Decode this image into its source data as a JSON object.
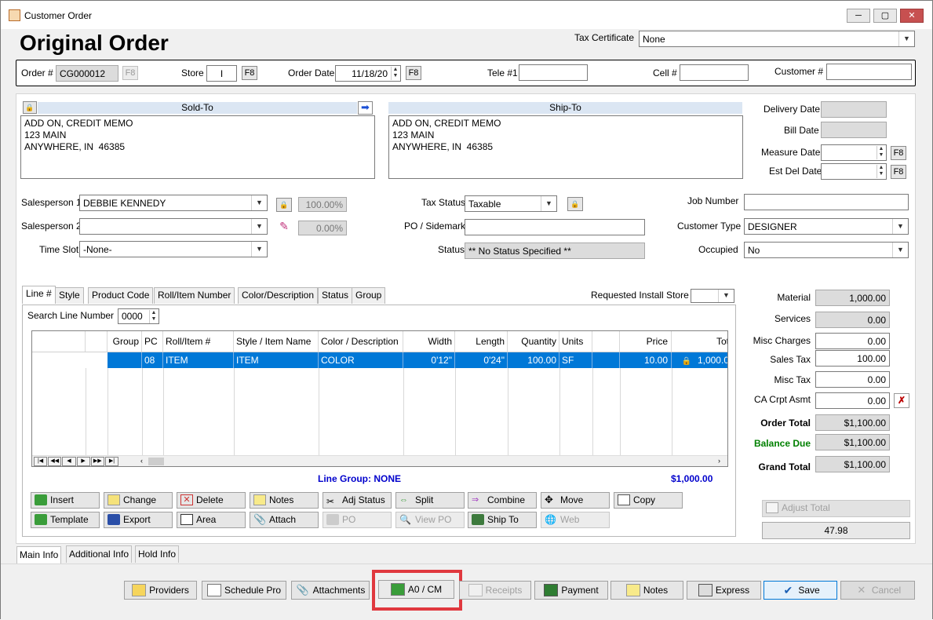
{
  "window": {
    "title": "Customer Order",
    "min": "─",
    "max": "▢",
    "close": "✕"
  },
  "page_title": "Original Order",
  "tax_certificate": {
    "label": "Tax Certificate",
    "value": "None"
  },
  "header": {
    "order_label": "Order #",
    "order_value": "CG000012",
    "f8": "F8",
    "store_label": "Store",
    "store_value": "I",
    "order_date_label": "Order Date",
    "order_date_value": "11/18/20",
    "tele_label": "Tele #1",
    "tele_value": "",
    "cell_label": "Cell #",
    "cell_value": "",
    "customer_label": "Customer #",
    "customer_value": ""
  },
  "sold_to": {
    "title": "Sold-To",
    "address": "ADD ON, CREDIT MEMO\n123 MAIN\nANYWHERE, IN  46385"
  },
  "ship_to": {
    "title": "Ship-To",
    "address": "ADD ON, CREDIT MEMO\n123 MAIN\nANYWHERE, IN  46385"
  },
  "dates": {
    "delivery_label": "Delivery Date",
    "bill_label": "Bill Date",
    "measure_label": "Measure Date",
    "est_del_label": "Est Del Date",
    "f8": "F8"
  },
  "sales": {
    "sp1_label": "Salesperson 1",
    "sp1_value": "DEBBIE KENNEDY",
    "sp1_pct": "100.00%",
    "sp2_label": "Salesperson 2",
    "sp2_value": "",
    "sp2_pct": "0.00%",
    "timeslot_label": "Time Slot",
    "timeslot_value": "-None-"
  },
  "mid": {
    "tax_status_label": "Tax Status",
    "tax_status_value": "Taxable",
    "po_label": "PO / Sidemark",
    "po_value": "",
    "status_label": "Status",
    "status_value": "** No Status Specified **"
  },
  "right": {
    "job_label": "Job Number",
    "job_value": "",
    "cust_type_label": "Customer Type",
    "cust_type_value": "DESIGNER",
    "occupied_label": "Occupied",
    "occupied_value": "No"
  },
  "line_tabs": [
    "Line #",
    "Style",
    "Product Code",
    "Roll/Item Number",
    "Color/Description",
    "Status",
    "Group"
  ],
  "requested_install_store": {
    "label": "Requested Install Store",
    "value": ""
  },
  "search": {
    "label": "Search Line Number",
    "value": "0000"
  },
  "grid": {
    "headers": [
      "Group",
      "PC",
      "Roll/Item #",
      "Style / Item Name",
      "Color / Description",
      "Width",
      "Length",
      "Quantity",
      "Units",
      "",
      "Price",
      "Tot"
    ],
    "row": [
      "",
      "08",
      "ITEM",
      "ITEM",
      "COLOR",
      "0'12\"",
      "0'24\"",
      "100.00",
      "SF",
      "",
      "10.00",
      "1,000.0"
    ]
  },
  "nav": [
    "|◀",
    "◀◀",
    "◀",
    "▶",
    "▶▶",
    "▶|"
  ],
  "line_group": "Line Group: NONE",
  "line_total": "$1,000.00",
  "buttons_row1": [
    "Insert",
    "Change",
    "Delete",
    "Notes",
    "Adj Status",
    "Split",
    "Combine",
    "Move",
    "Copy"
  ],
  "buttons_row2": [
    "Template",
    "Export",
    "Area",
    "Attach",
    "PO",
    "View PO",
    "Ship To",
    "Web"
  ],
  "summary": {
    "material_label": "Material",
    "material": "1,000.00",
    "services_label": "Services",
    "services": "0.00",
    "misc_charges_label": "Misc Charges",
    "misc_charges": "0.00",
    "sales_tax_label": "Sales Tax",
    "sales_tax": "100.00",
    "misc_tax_label": "Misc Tax",
    "misc_tax": "0.00",
    "ca_label": "CA Crpt Asmt",
    "ca": "0.00",
    "order_total_label": "Order Total",
    "order_total": "$1,100.00",
    "balance_label": "Balance Due",
    "balance": "$1,100.00",
    "grand_label": "Grand Total",
    "grand": "$1,100.00",
    "adjust_label": "Adjust Total",
    "adjust_value": "47.98"
  },
  "bottom_tabs": [
    "Main Info",
    "Additional Info",
    "Hold Info"
  ],
  "footer_buttons": [
    "Providers",
    "Schedule Pro",
    "Attachments",
    "A0 / CM",
    "Receipts",
    "Payment",
    "Notes",
    "Express",
    "Save",
    "Cancel"
  ],
  "colors": {
    "selection": "#0078d7",
    "highlight_box": "#e0383e",
    "balance_green": "#008000",
    "line_group_blue": "#0000cc"
  }
}
